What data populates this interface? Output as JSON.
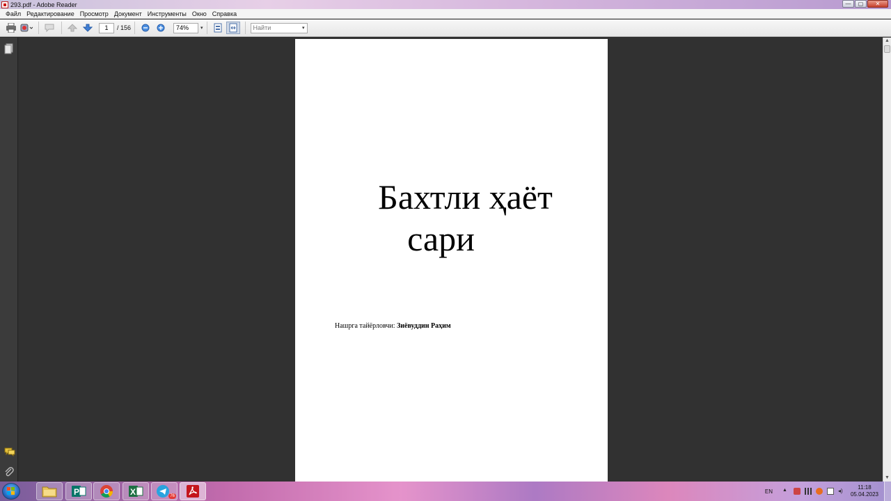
{
  "window": {
    "title": "293.pdf - Adobe Reader",
    "controls": [
      "—",
      "▢",
      "✕"
    ]
  },
  "menu": [
    "Файл",
    "Редактирование",
    "Просмотр",
    "Документ",
    "Инструменты",
    "Окно",
    "Справка"
  ],
  "toolbar": {
    "page_current": "1",
    "page_total": "/ 156",
    "zoom": "74%",
    "find_placeholder": "Найти"
  },
  "document": {
    "title_line1": "Бахтли ҳаёт",
    "title_line2": "сари",
    "credit_label": "Нашрга тайёрловчи:",
    "credit_name": "Зиёвуддин Раҳим"
  },
  "tray": {
    "lang": "EN",
    "time": "11:18",
    "date": "05.04.2023",
    "telegram_badge": "76"
  },
  "colors": {
    "accent_pdf": "#c4161c",
    "page_bg": "#ffffff",
    "workspace_bg": "#313131"
  }
}
